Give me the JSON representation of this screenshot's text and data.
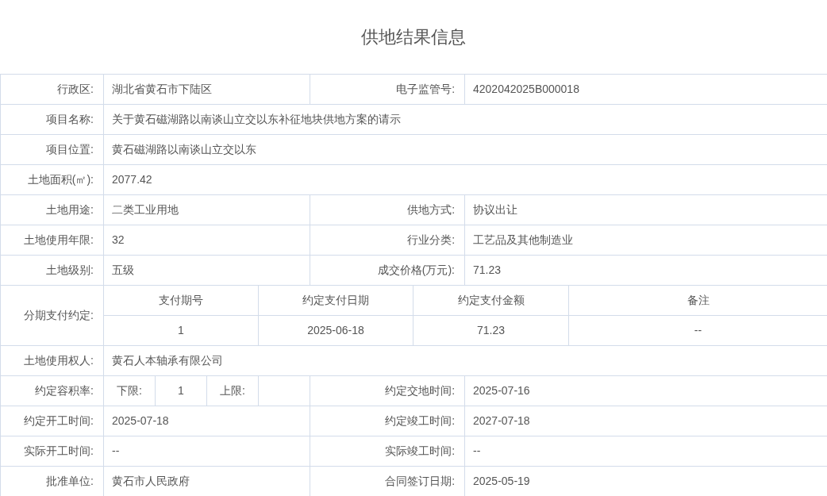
{
  "title": "供地结果信息",
  "rows": [
    {
      "kind": "pair",
      "fields": [
        {
          "label": "行政区:",
          "value": "湖北省黄石市下陆区"
        },
        {
          "label": "电子监管号:",
          "value": "4202042025B000018"
        }
      ]
    },
    {
      "kind": "full",
      "label": "项目名称:",
      "value": "关于黄石磁湖路以南谈山立交以东补征地块供地方案的请示"
    },
    {
      "kind": "full",
      "label": "项目位置:",
      "value": "黄石磁湖路以南谈山立交以东"
    },
    {
      "kind": "full",
      "label": "土地面积(㎡):",
      "value": "2077.42"
    },
    {
      "kind": "pair",
      "fields": [
        {
          "label": "土地用途:",
          "value": "二类工业用地"
        },
        {
          "label": "供地方式:",
          "value": "协议出让"
        }
      ]
    },
    {
      "kind": "pair",
      "fields": [
        {
          "label": "土地使用年限:",
          "value": "32"
        },
        {
          "label": "行业分类:",
          "value": "工艺品及其他制造业"
        }
      ]
    },
    {
      "kind": "pair",
      "fields": [
        {
          "label": "土地级别:",
          "value": "五级"
        },
        {
          "label": "成交价格(万元):",
          "value": "71.23"
        }
      ]
    },
    {
      "kind": "installments",
      "label": "分期支付约定:",
      "columns": [
        "支付期号",
        "约定支付日期",
        "约定支付金额",
        "备注"
      ],
      "rows": [
        [
          "1",
          "2025-06-18",
          "71.23",
          "--"
        ]
      ]
    },
    {
      "kind": "full",
      "label": "土地使用权人:",
      "value": "黄石人本轴承有限公司"
    },
    {
      "kind": "ratio",
      "label": "约定容积率:",
      "lower_label": "下限:",
      "lower_value": "1",
      "upper_label": "上限:",
      "field": {
        "label": "约定交地时间:",
        "value": "2025-07-16"
      }
    },
    {
      "kind": "pair",
      "fields": [
        {
          "label": "约定开工时间:",
          "value": "2025-07-18"
        },
        {
          "label": "约定竣工时间:",
          "value": "2027-07-18"
        }
      ]
    },
    {
      "kind": "pair",
      "fields": [
        {
          "label": "实际开工时间:",
          "value": "--"
        },
        {
          "label": "实际竣工时间:",
          "value": "--"
        }
      ]
    },
    {
      "kind": "pair",
      "fields": [
        {
          "label": "批准单位:",
          "value": "黄石市人民政府"
        },
        {
          "label": "合同签订日期:",
          "value": "2025-05-19"
        }
      ]
    }
  ]
}
